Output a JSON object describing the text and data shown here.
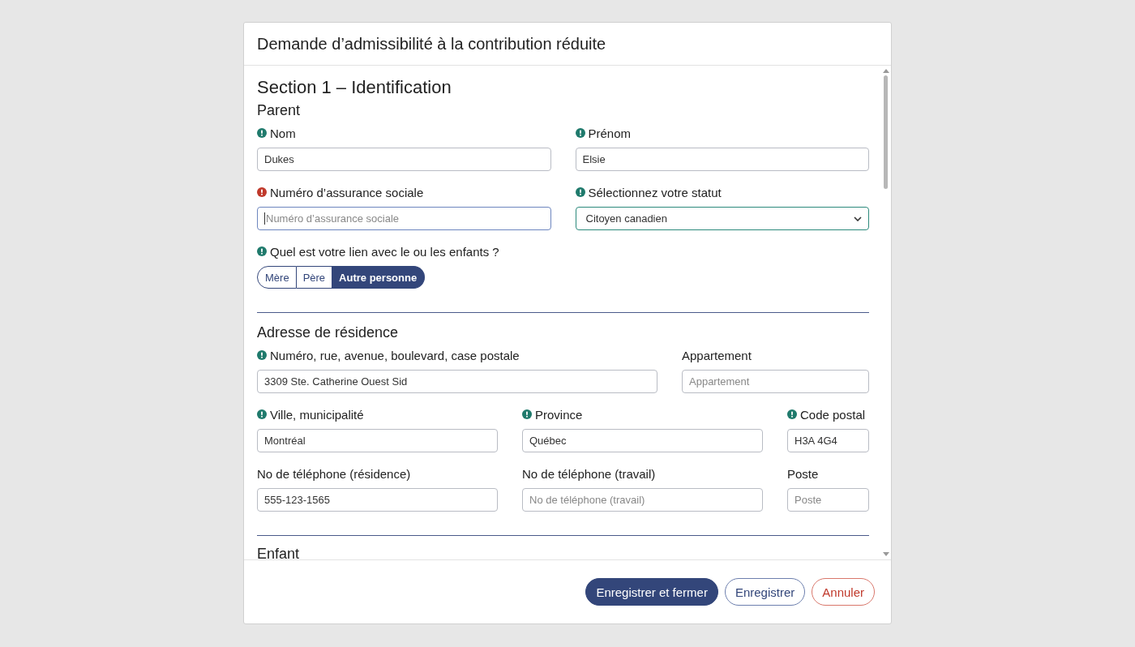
{
  "dialog": {
    "title": "Demande d’admissibilité à la contribution réduite"
  },
  "section_title": "Section 1 – Identification",
  "parent": {
    "heading": "Parent",
    "rows": [
      {
        "kind": "half",
        "fields": [
          {
            "label": "Nom",
            "required": true,
            "invalid": false,
            "kind": "input",
            "value": "Dukes",
            "focused": false,
            "valid": false
          },
          {
            "label": "Prénom",
            "required": true,
            "invalid": false,
            "kind": "input",
            "value": "Elsie",
            "focused": false,
            "valid": false
          }
        ]
      },
      {
        "kind": "half",
        "fields": [
          {
            "label": "Numéro d’assurance sociale",
            "required": true,
            "invalid": true,
            "kind": "input",
            "placeholder": "Numéro d’assurance sociale",
            "focused": true,
            "valid": false
          },
          {
            "label": "Sélectionnez votre statut",
            "required": true,
            "invalid": false,
            "kind": "select",
            "value": "Citoyen canadien",
            "focused": false,
            "valid": true
          }
        ]
      }
    ],
    "relation": {
      "label": "Quel est votre lien avec le ou les enfants ?",
      "required": true,
      "invalid": false,
      "options": [
        {
          "label": "Mère",
          "selected": false
        },
        {
          "label": "Père",
          "selected": false
        },
        {
          "label": "Autre personne",
          "selected": true
        }
      ]
    }
  },
  "address": {
    "heading": "Adresse de résidence",
    "rows": [
      {
        "kind": "wide",
        "fields": [
          {
            "label": "Numéro, rue, avenue, boulevard, case postale",
            "required": true,
            "invalid": false,
            "kind": "input",
            "value": "3309  Ste. Catherine Ouest Sid",
            "focused": false,
            "valid": false
          },
          {
            "label": "Appartement",
            "required": false,
            "invalid": false,
            "kind": "input",
            "placeholder": "Appartement",
            "focused": false,
            "valid": false
          }
        ]
      },
      {
        "kind": "thirds",
        "fields": [
          {
            "label": "Ville, municipalité",
            "required": true,
            "invalid": false,
            "kind": "input",
            "value": "Montréal",
            "focused": false,
            "valid": false
          },
          {
            "label": "Province",
            "required": true,
            "invalid": false,
            "kind": "input",
            "value": "Québec",
            "focused": false,
            "valid": false
          },
          {
            "label": "Code postal",
            "required": true,
            "invalid": false,
            "kind": "input",
            "value": "H3A 4G4",
            "focused": false,
            "valid": false
          }
        ]
      },
      {
        "kind": "thirds",
        "fields": [
          {
            "label": "No de téléphone (résidence)",
            "required": false,
            "invalid": false,
            "kind": "input",
            "value": "555-123-1565",
            "focused": false,
            "valid": false
          },
          {
            "label": "No de téléphone (travail)",
            "required": false,
            "invalid": false,
            "kind": "input",
            "placeholder": "No de téléphone (travail)",
            "focused": false,
            "valid": false
          },
          {
            "label": "Poste",
            "required": false,
            "invalid": false,
            "kind": "input",
            "placeholder": "Poste",
            "focused": false,
            "valid": false
          }
        ]
      }
    ]
  },
  "child": {
    "heading": "Enfant"
  },
  "buttons": [
    {
      "label": "Enregistrer et fermer",
      "kind": "primary"
    },
    {
      "label": "Enregistrer",
      "kind": "secondary"
    },
    {
      "label": "Annuler",
      "kind": "danger"
    }
  ]
}
